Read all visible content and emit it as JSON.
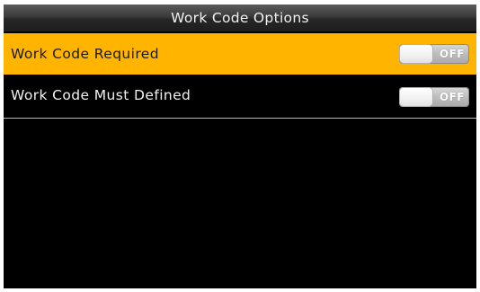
{
  "header": {
    "title": "Work Code Options"
  },
  "options": [
    {
      "label": "Work Code Required",
      "toggle_state": "OFF",
      "selected": true
    },
    {
      "label": "Work Code Must Defined",
      "toggle_state": "OFF",
      "selected": false
    }
  ],
  "colors": {
    "highlight": "#ffb400",
    "background": "#000000",
    "title_bar": "#3a3a3a",
    "toggle_off": "#bdbdbd"
  }
}
